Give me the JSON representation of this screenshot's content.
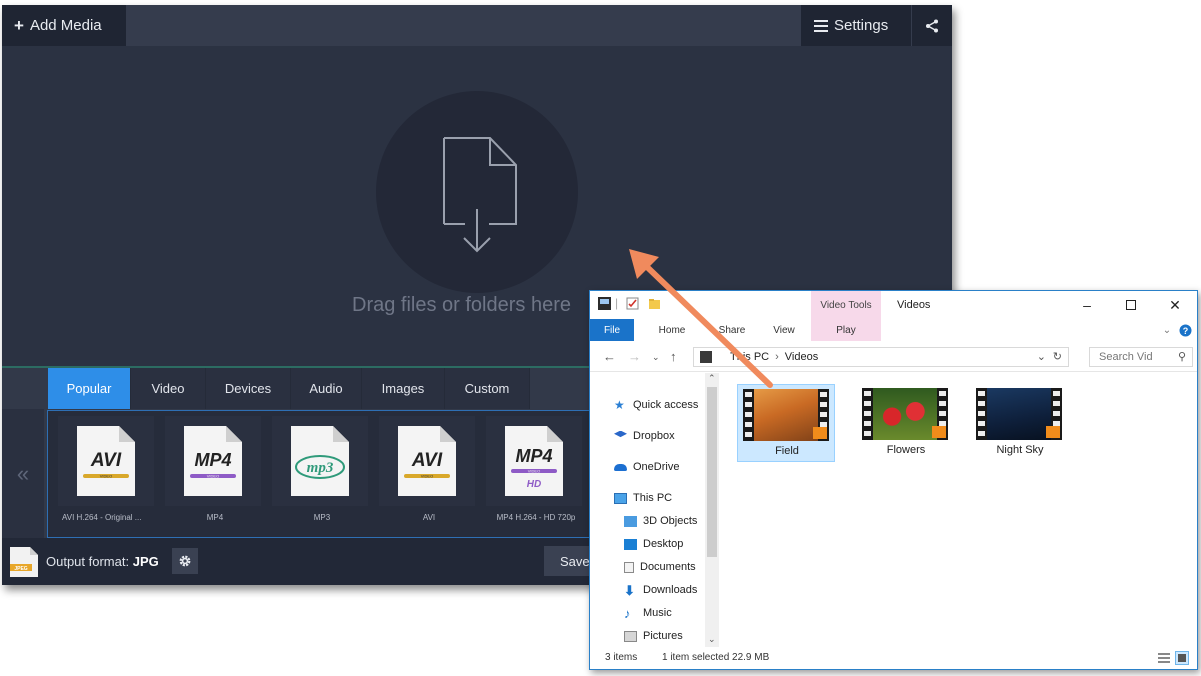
{
  "app": {
    "add_media": "Add Media",
    "settings": "Settings",
    "drop_hint": "Drag files or folders here",
    "tabs": [
      "Popular",
      "Video",
      "Devices",
      "Audio",
      "Images",
      "Custom"
    ],
    "scroll_left": "«",
    "presets": [
      {
        "badge": "AVI",
        "sub": "VIDEO",
        "caption": "AVI H.264 - Original ..."
      },
      {
        "badge": "MP4",
        "sub": "VIDEO",
        "caption": "MP4"
      },
      {
        "badge": "mp3",
        "sub": "",
        "caption": "MP3"
      },
      {
        "badge": "AVI",
        "sub": "VIDEO",
        "caption": "AVI"
      },
      {
        "badge": "MP4",
        "sub": "VIDEO",
        "hd": "HD",
        "caption": "MP4 H.264 - HD 720p"
      }
    ],
    "output_label": "Output format:",
    "output_value": "JPG",
    "jpg_icon_text": "JPEG",
    "save_label": "Save"
  },
  "explorer": {
    "contextual_tab": "Video Tools",
    "window_title": "Videos",
    "ribbon_tabs": [
      "File",
      "Home",
      "Share",
      "View",
      "Play"
    ],
    "address": [
      "This PC",
      "Videos"
    ],
    "search_placeholder": "Search Vid",
    "nav": [
      "Quick access",
      "Dropbox",
      "OneDrive",
      "This PC",
      "3D Objects",
      "Desktop",
      "Documents",
      "Downloads",
      "Music",
      "Pictures"
    ],
    "files": [
      "Field",
      "Flowers",
      "Night Sky"
    ],
    "status_items": "3 items",
    "status_selected": "1 item selected  22.9 MB"
  },
  "colors": {
    "app_bg": "#2b3242",
    "accent_blue": "#2e8ee8",
    "arrow": "#f08a5d",
    "explorer_border": "#2a80c8",
    "selection": "#cce8ff"
  }
}
